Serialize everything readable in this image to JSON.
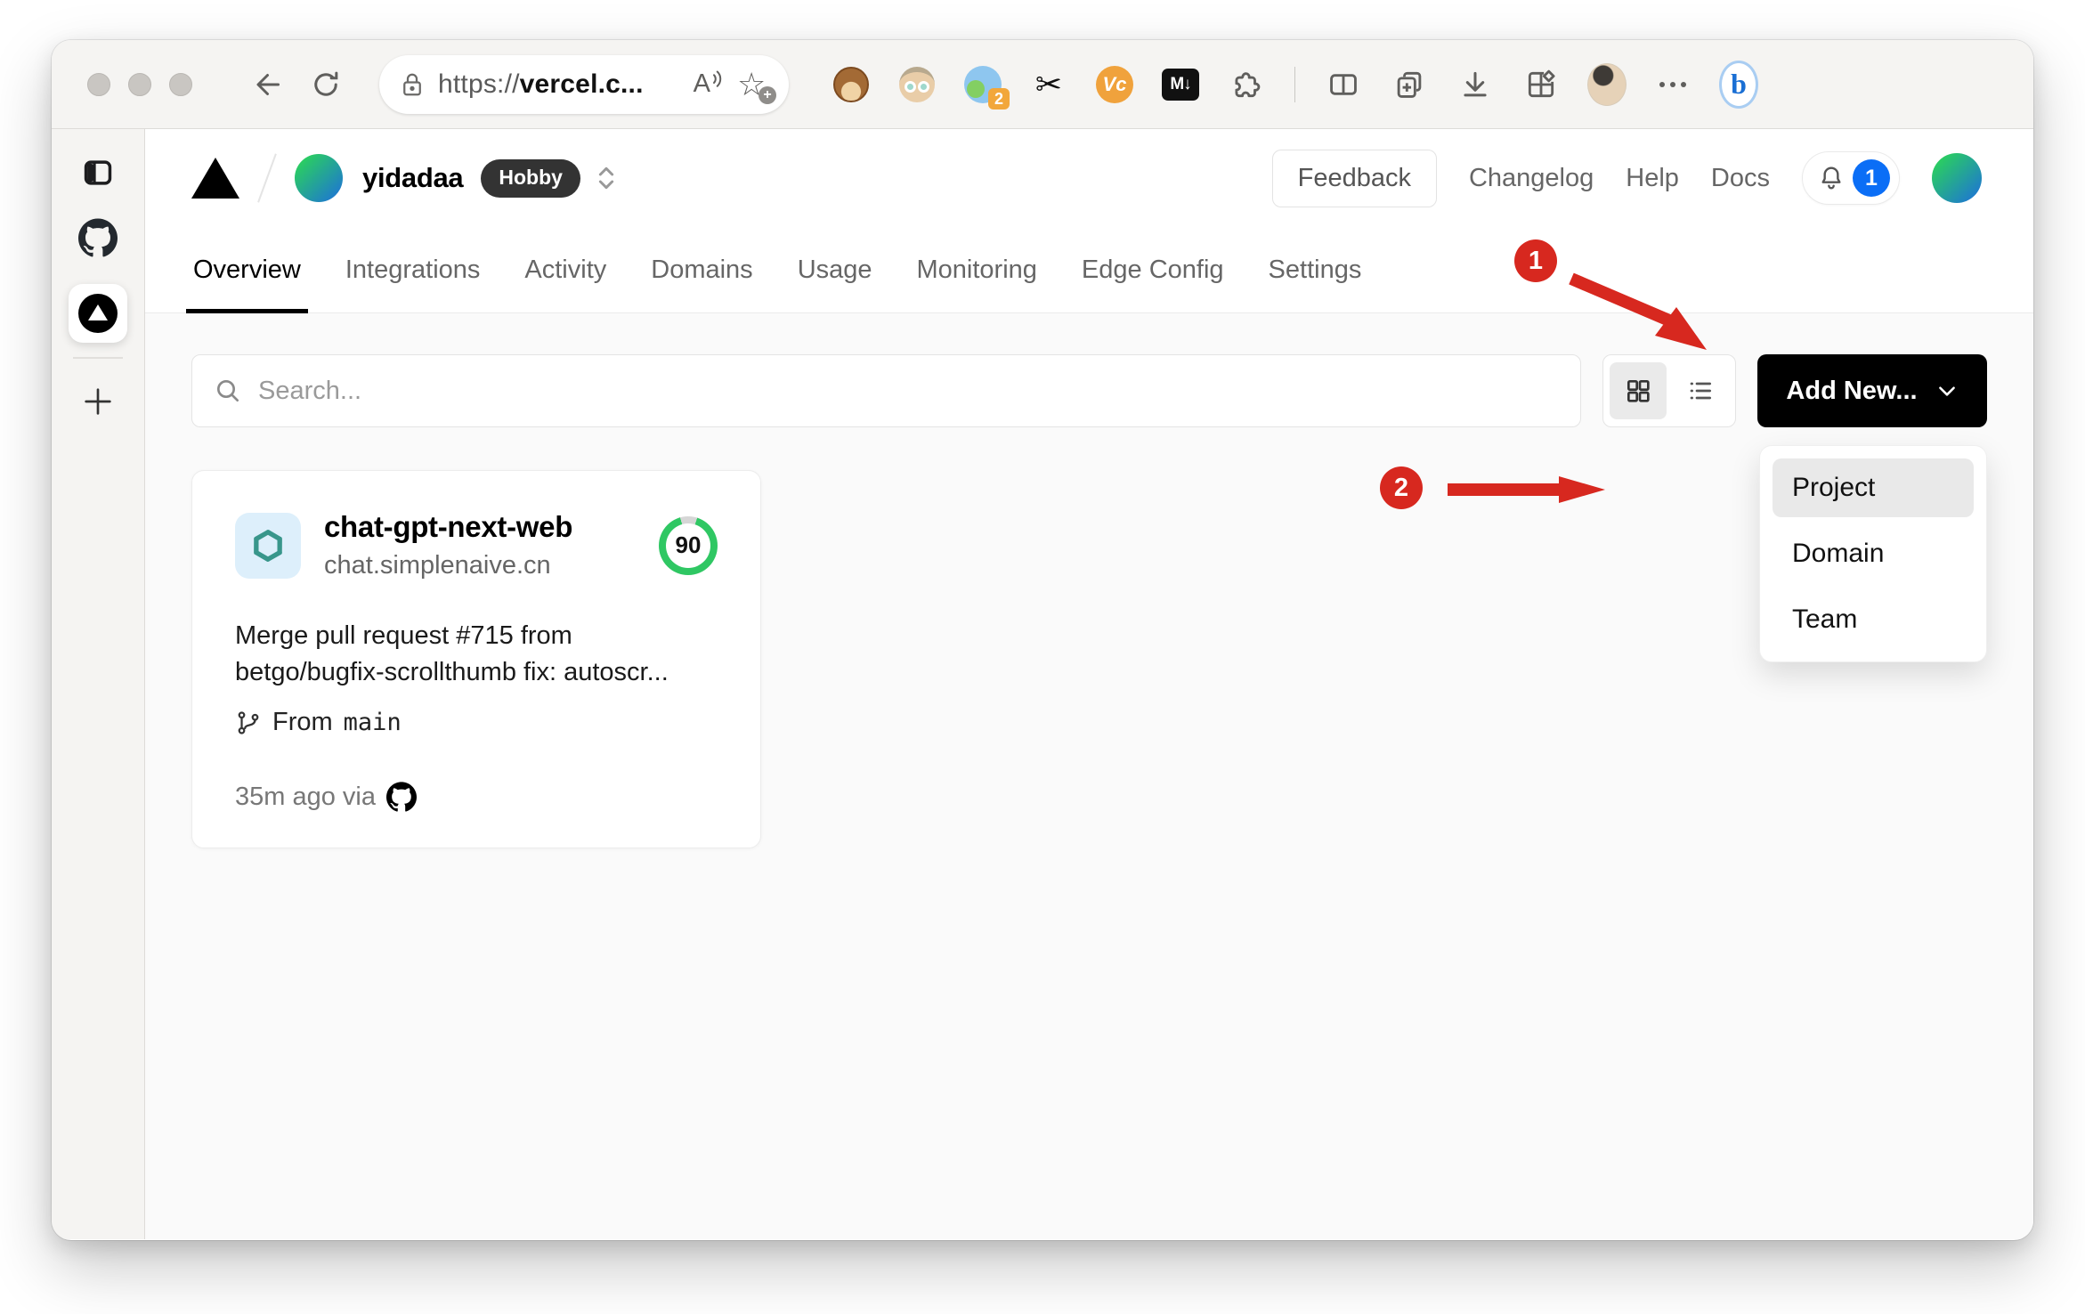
{
  "browser": {
    "url_scheme": "https://",
    "url_host": "vercel.c...",
    "read_aloud_label": "A",
    "extension_badge": "2",
    "vc_label": "Vc",
    "markdown_label": "M↓",
    "bing_label": "b"
  },
  "header": {
    "team": "yidadaa",
    "plan": "Hobby",
    "links": [
      "Feedback",
      "Changelog",
      "Help",
      "Docs"
    ],
    "notification_count": "1"
  },
  "tabs": [
    {
      "label": "Overview",
      "active": true
    },
    {
      "label": "Integrations",
      "active": false
    },
    {
      "label": "Activity",
      "active": false
    },
    {
      "label": "Domains",
      "active": false
    },
    {
      "label": "Usage",
      "active": false
    },
    {
      "label": "Monitoring",
      "active": false
    },
    {
      "label": "Edge Config",
      "active": false
    },
    {
      "label": "Settings",
      "active": false
    }
  ],
  "content": {
    "search_placeholder": "Search...",
    "add_new_label": "Add New..."
  },
  "dropdown": {
    "items": [
      {
        "label": "Project",
        "highlighted": true
      },
      {
        "label": "Domain",
        "highlighted": false
      },
      {
        "label": "Team",
        "highlighted": false
      }
    ]
  },
  "project_card": {
    "name": "chat-gpt-next-web",
    "domain": "chat.simplenaive.cn",
    "score": "90",
    "commit_line1": "Merge pull request #715 from",
    "commit_line2": "betgo/bugfix-scrollthumb fix: autoscr...",
    "branch_prefix": "From",
    "branch_name": "main",
    "deployed": "35m ago via"
  },
  "annotations": [
    {
      "number": "1"
    },
    {
      "number": "2"
    }
  ],
  "colors": {
    "annotation_red": "#d7281f",
    "notification_blue": "#0b6ef6",
    "score_green": "#2fc763",
    "openai_teal": "#38968b",
    "accent_black": "#000000",
    "content_background": "#fafafa",
    "avatar_gradient": [
      "#2bd25b",
      "#1e78d0"
    ]
  }
}
